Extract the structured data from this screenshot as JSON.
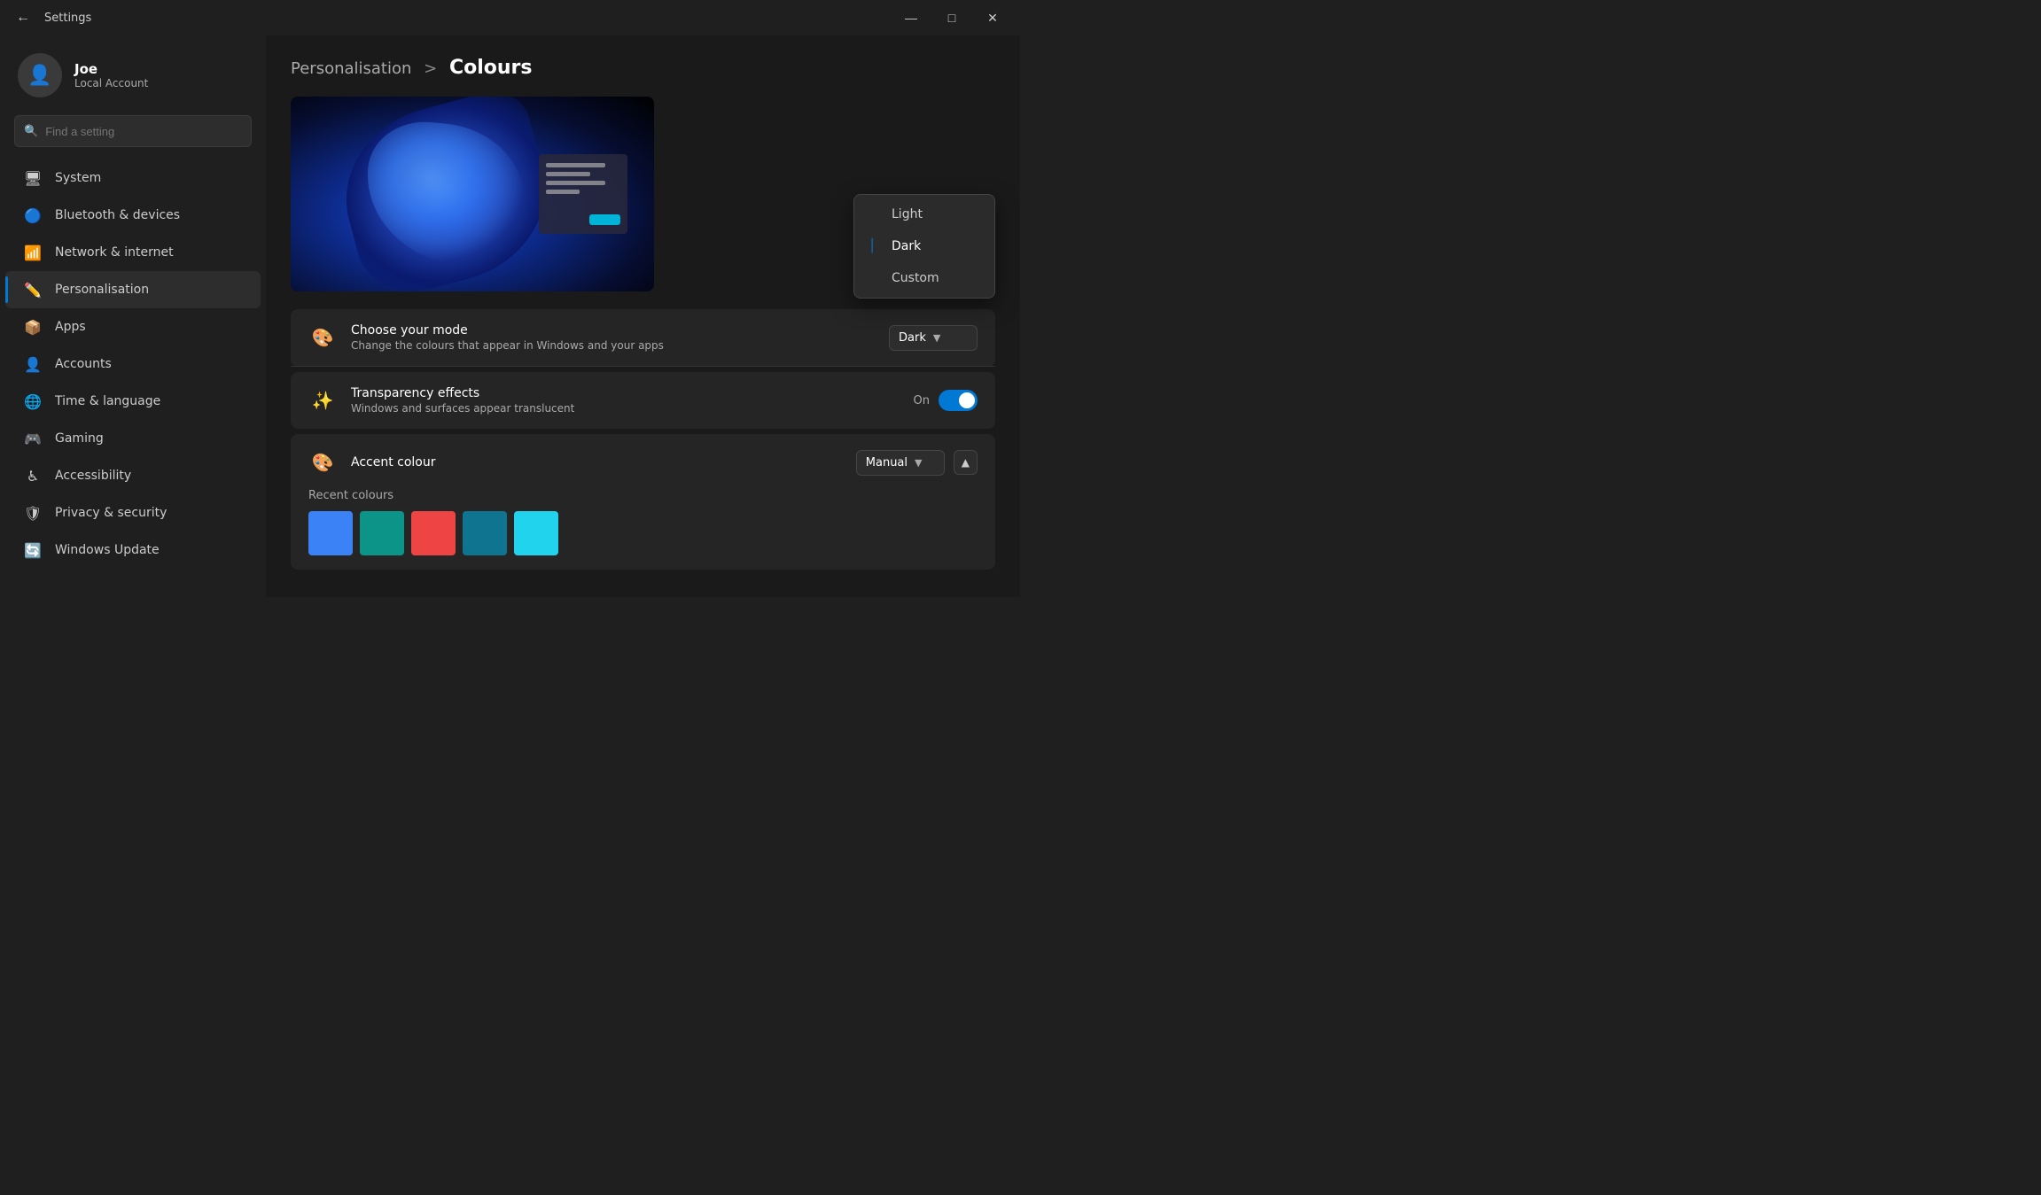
{
  "titlebar": {
    "title": "Settings",
    "minimize": "—",
    "maximize": "□",
    "close": "✕"
  },
  "user": {
    "name": "Joe",
    "account_type": "Local Account"
  },
  "search": {
    "placeholder": "Find a setting"
  },
  "nav": {
    "items": [
      {
        "id": "system",
        "label": "System",
        "icon": "🖥"
      },
      {
        "id": "bluetooth",
        "label": "Bluetooth & devices",
        "icon": "🔵"
      },
      {
        "id": "network",
        "label": "Network & internet",
        "icon": "📶"
      },
      {
        "id": "personalisation",
        "label": "Personalisation",
        "icon": "✏️",
        "active": true
      },
      {
        "id": "apps",
        "label": "Apps",
        "icon": "📦"
      },
      {
        "id": "accounts",
        "label": "Accounts",
        "icon": "👤"
      },
      {
        "id": "time",
        "label": "Time & language",
        "icon": "🌐"
      },
      {
        "id": "gaming",
        "label": "Gaming",
        "icon": "🎮"
      },
      {
        "id": "accessibility",
        "label": "Accessibility",
        "icon": "♿"
      },
      {
        "id": "privacy",
        "label": "Privacy & security",
        "icon": "🛡"
      },
      {
        "id": "update",
        "label": "Windows Update",
        "icon": "🔄"
      }
    ]
  },
  "breadcrumb": {
    "parent": "Personalisation",
    "separator": ">",
    "current": "Colours"
  },
  "settings": {
    "mode_row": {
      "title": "Choose your mode",
      "subtitle": "Change the colours that appear in Windows and your apps"
    },
    "transparency_row": {
      "title": "Transparency effects",
      "subtitle": "Windows and surfaces appear translucent",
      "toggle_label": "On"
    },
    "accent_row": {
      "title": "Accent colour",
      "dropdown_value": "Manual"
    },
    "recent_colours": {
      "label": "Recent colours",
      "swatches": [
        "#3b82f6",
        "#0d9488",
        "#ef4444",
        "#0e7490",
        "#22d3ee"
      ]
    }
  },
  "mode_dropdown": {
    "options": [
      {
        "label": "Light",
        "selected": false
      },
      {
        "label": "Dark",
        "selected": true
      },
      {
        "label": "Custom",
        "selected": false
      }
    ]
  }
}
